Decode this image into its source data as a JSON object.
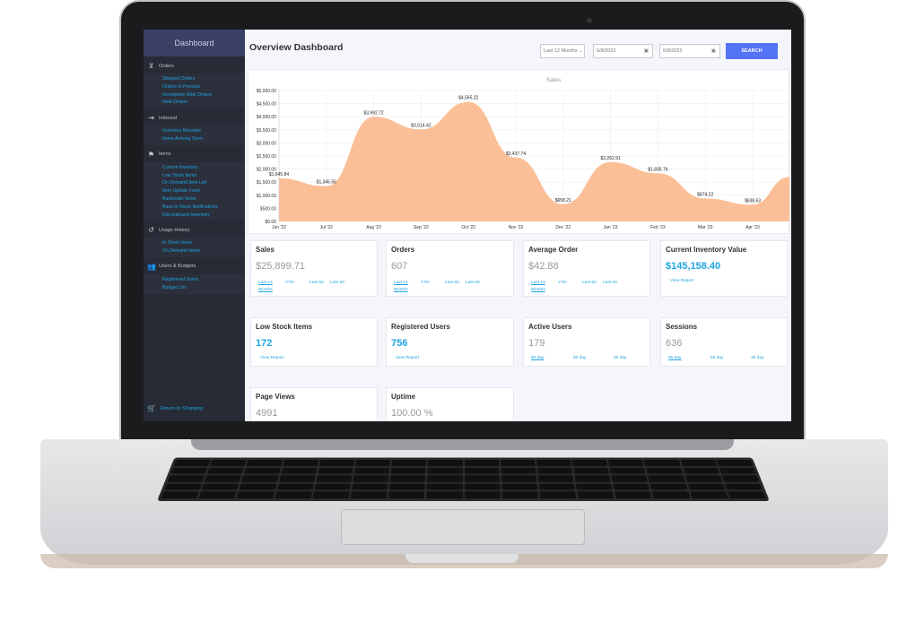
{
  "sidebar": {
    "title": "Dashboard",
    "sections": [
      {
        "label": "Orders",
        "icon": "inbox-icon",
        "items": [
          "Shipped Orders",
          "Orders In Process",
          "Incomplete Web Orders",
          "Held Orders"
        ]
      },
      {
        "label": "Inbound",
        "icon": "sign-in-icon",
        "items": [
          "Inventory Receipts",
          "Items Arriving Soon"
        ]
      },
      {
        "label": "Items",
        "icon": "box-hand-icon",
        "items": [
          "Current Inventory",
          "Low Stock Items",
          "On Demand Item List",
          "Item Update Feed",
          "Backorder Items",
          "Back-In Stock Notifications",
          "Discontinued Inventory"
        ]
      },
      {
        "label": "Usage History",
        "icon": "history-icon",
        "items": [
          "In Stock Items",
          "On Demand Items"
        ]
      },
      {
        "label": "Users & Budgets",
        "icon": "users-icon",
        "items": [
          "Registered Users",
          "Budget List"
        ]
      }
    ],
    "return_label": "Return to Shopping"
  },
  "header": {
    "title": "Overview Dashboard",
    "range_select": "Last 12 Months",
    "start_date": "6/8/2022",
    "end_date": "6/8/2023",
    "search_label": "SEARCH"
  },
  "chart_data": {
    "type": "area",
    "title": "Sales",
    "categories": [
      "Jun '22",
      "Jul '22",
      "Aug '22",
      "Sep '22",
      "Oct '22",
      "Nov '22",
      "Dec '22",
      "Jan '23",
      "Feb '23",
      "Mar '23",
      "Apr '23"
    ],
    "values": [
      1645.84,
      1345.55,
      3992.72,
      3514.42,
      4565.22,
      2437.74,
      658.21,
      2262.91,
      1835.76,
      874.22,
      638.63
    ],
    "labels": [
      "$1,645.84",
      "$1,345.55",
      "$3,992.72",
      "$3,514.42",
      "$4,565.22",
      "$2,437.74",
      "$658.21",
      "$2,262.91",
      "$1,835.76",
      "$874.22",
      "$638.63"
    ],
    "trailing_value": 1700,
    "yticks": [
      "$0.00",
      "$500.00",
      "$1,000.00",
      "$1,500.00",
      "$2,000.00",
      "$2,500.00",
      "$3,000.00",
      "$3,500.00",
      "$4,000.00",
      "$4,500.00",
      "$5,000.00"
    ],
    "ylim": [
      0,
      5000
    ],
    "grid": true,
    "fill_color": "#fbbf98"
  },
  "cards": [
    {
      "title": "Sales",
      "value": "$25,899.71",
      "highlight": false,
      "links": [
        "Last 12 Months",
        "YTD",
        "Last 60",
        "Last 30"
      ]
    },
    {
      "title": "Orders",
      "value": "607",
      "highlight": false,
      "links": [
        "Last 12 Months",
        "YTD",
        "Last 60",
        "Last 30"
      ]
    },
    {
      "title": "Average Order",
      "value": "$42.88",
      "highlight": false,
      "links": [
        "Last 12 Months",
        "YTD",
        "Last 60",
        "Last 30"
      ]
    },
    {
      "title": "Current Inventory Value",
      "value": "$145,158.40",
      "highlight": true,
      "links": [
        "View Report"
      ]
    },
    {
      "title": "Low Stock Items",
      "value": "172",
      "highlight": true,
      "links": [
        "View Report"
      ]
    },
    {
      "title": "Registered Users",
      "value": "756",
      "highlight": true,
      "links": [
        "View Report"
      ]
    },
    {
      "title": "Active Users",
      "value": "179",
      "highlight": false,
      "links": [
        "90 day",
        "60 day",
        "30 day"
      ]
    },
    {
      "title": "Sessions",
      "value": "636",
      "highlight": false,
      "links": [
        "90 day",
        "60 day",
        "30 day"
      ]
    },
    {
      "title": "Page Views",
      "value": "4991",
      "highlight": false,
      "links": []
    },
    {
      "title": "Uptime",
      "value": "100.00 %",
      "highlight": false,
      "links": []
    }
  ]
}
